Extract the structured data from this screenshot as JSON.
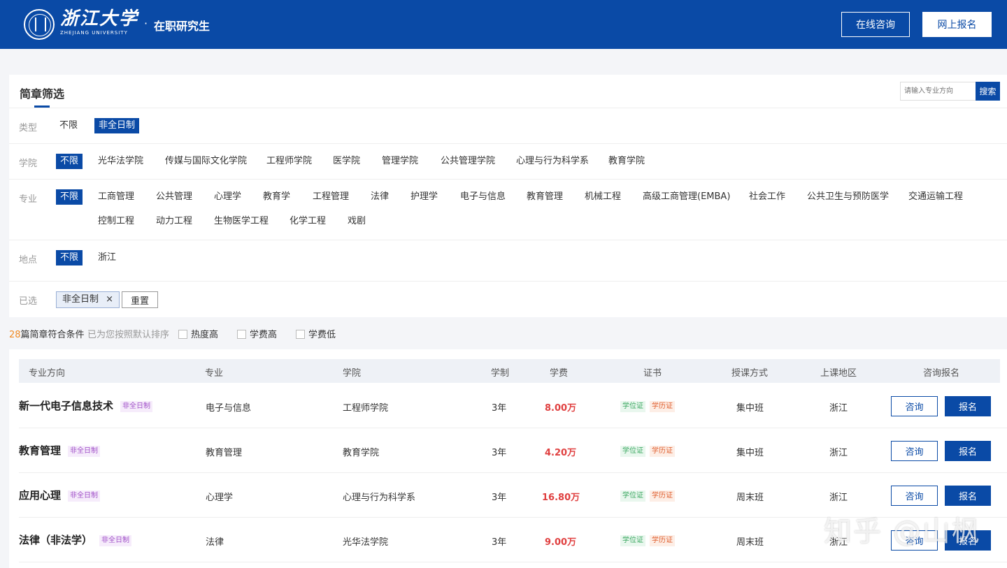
{
  "header": {
    "brand_cn": "浙江大学",
    "brand_en": "ZHEJIANG UNIVERSITY",
    "dot": "·",
    "subtitle": "在职研究生",
    "consult_btn": "在线咨询",
    "apply_btn": "网上报名",
    "color": "#0a4aa6"
  },
  "filter": {
    "title": "简章筛选",
    "search_placeholder": "请输入专业方向",
    "search_btn": "搜索",
    "type": {
      "label": "类型",
      "options": [
        "不限",
        "非全日制"
      ],
      "active": "非全日制"
    },
    "college": {
      "label": "学院",
      "options": [
        "不限",
        "光华法学院",
        "传媒与国际文化学院",
        "工程师学院",
        "医学院",
        "管理学院",
        "公共管理学院",
        "心理与行为科学系",
        "教育学院"
      ],
      "active": "不限"
    },
    "major": {
      "label": "专业",
      "options": [
        "不限",
        "工商管理",
        "公共管理",
        "心理学",
        "教育学",
        "工程管理",
        "法律",
        "护理学",
        "电子与信息",
        "教育管理",
        "机械工程",
        "高级工商管理(EMBA)",
        "社会工作",
        "公共卫生与预防医学",
        "交通运输工程",
        "控制工程",
        "动力工程",
        "生物医学工程",
        "化学工程",
        "戏剧"
      ],
      "active": "不限"
    },
    "location": {
      "label": "地点",
      "options": [
        "不限",
        "浙江"
      ],
      "active": "不限"
    }
  },
  "selected": {
    "label": "已选",
    "tag": "非全日制",
    "close": "×",
    "reset": "重置"
  },
  "results": {
    "count": "28",
    "count_suffix": "篇简章符合条件",
    "sort_hint": "已为您按照默认排序",
    "sort_options": [
      "热度高",
      "学费高",
      "学费低"
    ]
  },
  "table": {
    "headers": [
      "专业方向",
      "专业",
      "学院",
      "学制",
      "学费",
      "证书",
      "授课方式",
      "上课地区",
      "咨询报名"
    ],
    "rows": [
      {
        "name": "新一代电子信息技术",
        "badge": "非全日制",
        "major": "电子与信息",
        "college": "工程师学院",
        "years": "3年",
        "fee": "8.00万",
        "cert1": "学位证",
        "cert2": "学历证",
        "mode": "集中班",
        "region": "浙江",
        "consult": "咨询",
        "apply": "报名"
      },
      {
        "name": "教育管理",
        "badge": "非全日制",
        "major": "教育管理",
        "college": "教育学院",
        "years": "3年",
        "fee": "4.20万",
        "cert1": "学位证",
        "cert2": "学历证",
        "mode": "集中班",
        "region": "浙江",
        "consult": "咨询",
        "apply": "报名"
      },
      {
        "name": "应用心理",
        "badge": "非全日制",
        "major": "心理学",
        "college": "心理与行为科学系",
        "years": "3年",
        "fee": "16.80万",
        "cert1": "学位证",
        "cert2": "学历证",
        "mode": "周末班",
        "region": "浙江",
        "consult": "咨询",
        "apply": "报名"
      },
      {
        "name": "法律（非法学）",
        "badge": "非全日制",
        "major": "法律",
        "college": "光华法学院",
        "years": "3年",
        "fee": "9.00万",
        "cert1": "学位证",
        "cert2": "学历证",
        "mode": "周末班",
        "region": "浙江",
        "consult": "咨询",
        "apply": "报名"
      }
    ]
  },
  "watermark": "知乎 @山枫"
}
